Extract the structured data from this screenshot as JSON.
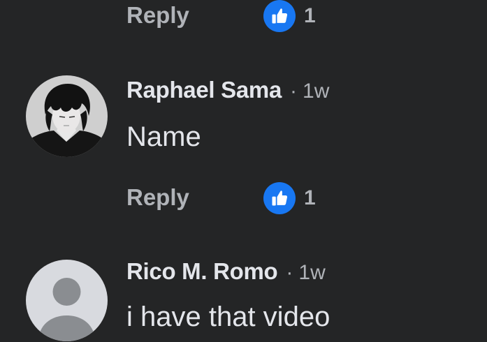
{
  "comments": [
    {
      "reply_label": "Reply",
      "like_count": "1"
    },
    {
      "author": "Raphael Sama",
      "separator": "·",
      "time": "1w",
      "text": "Name",
      "reply_label": "Reply",
      "like_count": "1"
    },
    {
      "author": "Rico M. Romo",
      "separator": "·",
      "time": "1w",
      "text": "i have that video"
    }
  ],
  "colors": {
    "background": "#242526",
    "primary_text": "#e4e6eb",
    "secondary_text": "#b0b3b8",
    "like_blue": "#1877f2"
  },
  "icons": {
    "like": "thumbs-up-icon",
    "default_avatar": "default-avatar-icon"
  }
}
